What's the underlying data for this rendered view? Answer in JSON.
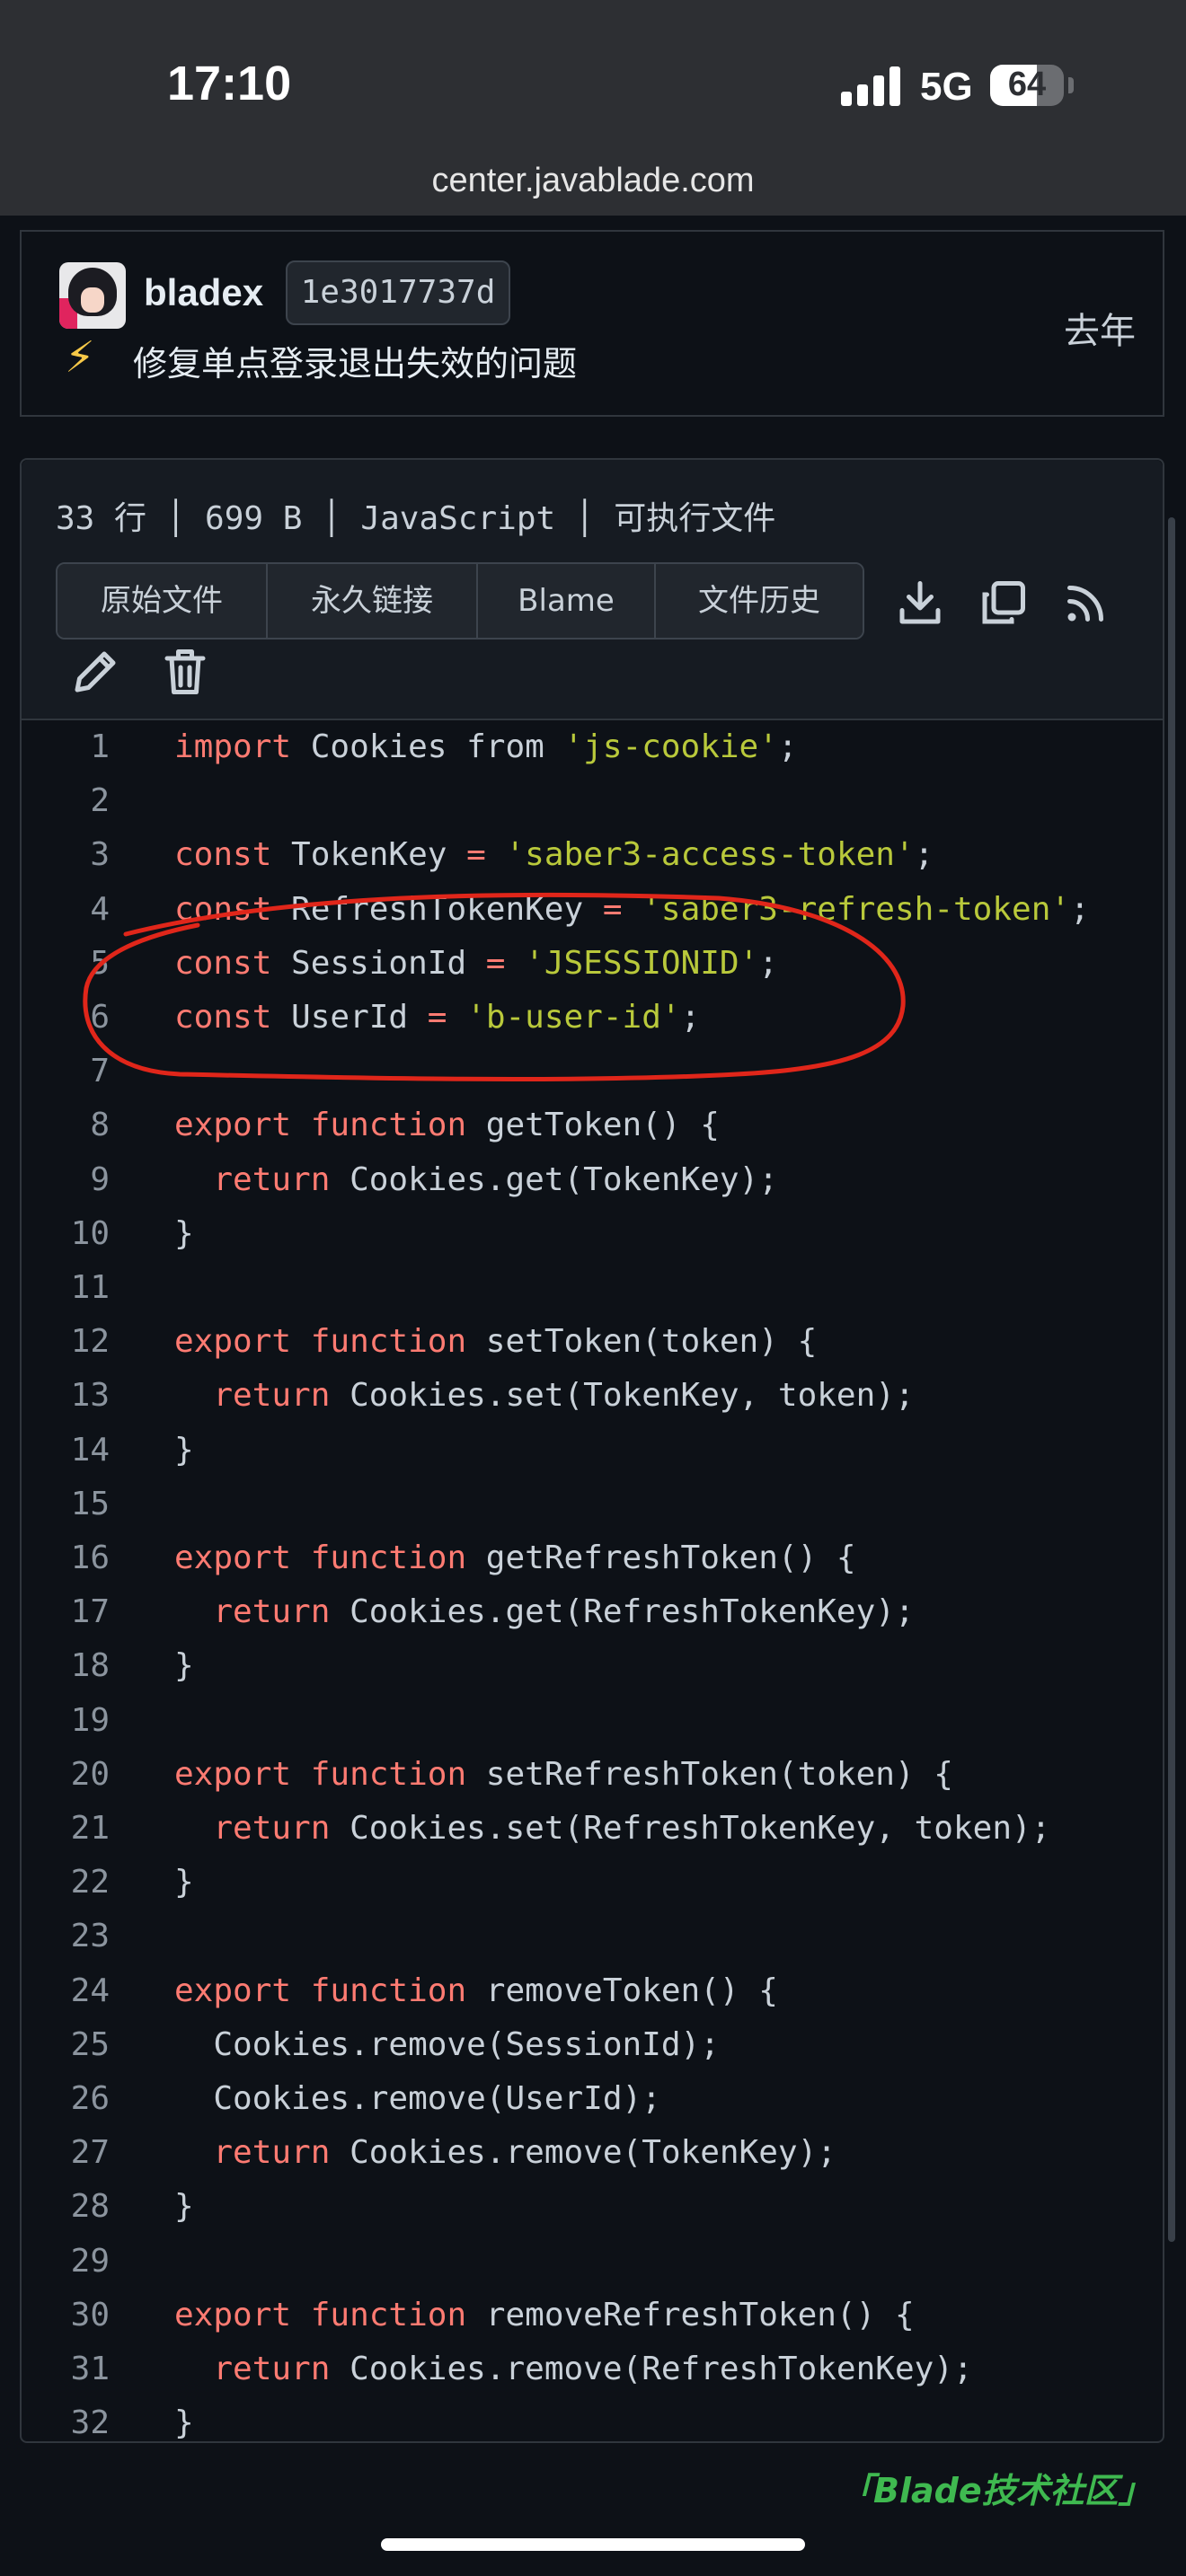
{
  "status_bar": {
    "time": "17:10",
    "network": "5G",
    "battery": 64,
    "battery_text": "64"
  },
  "browser": {
    "url": "center.javablade.com"
  },
  "commit": {
    "author": "bladex",
    "sha": "1e3017737d",
    "emoji": "⚡",
    "message": "修复单点登录退出失效的问题",
    "when": "去年"
  },
  "file": {
    "meta": "33 行 │ 699 B │ JavaScript │ 可执行文件",
    "buttons": [
      "原始文件",
      "永久链接",
      "Blame",
      "文件历史"
    ],
    "icons": [
      "download-icon",
      "copy-icon",
      "rss-icon",
      "edit-icon",
      "trash-icon"
    ]
  },
  "code": {
    "lines": [
      [
        [
          "kw",
          "import"
        ],
        [
          "t",
          " Cookies from "
        ],
        [
          "str",
          "'js-cookie'"
        ],
        [
          "t",
          ";"
        ]
      ],
      [],
      [
        [
          "kw",
          "const"
        ],
        [
          "t",
          " TokenKey "
        ],
        [
          "op",
          "="
        ],
        [
          "t",
          " "
        ],
        [
          "str",
          "'saber3-access-token'"
        ],
        [
          "t",
          ";"
        ]
      ],
      [
        [
          "kw",
          "const"
        ],
        [
          "t",
          " RefreshTokenKey "
        ],
        [
          "op",
          "="
        ],
        [
          "t",
          " "
        ],
        [
          "str",
          "'saber3-refresh-token'"
        ],
        [
          "t",
          ";"
        ]
      ],
      [
        [
          "kw",
          "const"
        ],
        [
          "t",
          " SessionId "
        ],
        [
          "op",
          "="
        ],
        [
          "t",
          " "
        ],
        [
          "str",
          "'JSESSIONID'"
        ],
        [
          "t",
          ";"
        ]
      ],
      [
        [
          "kw",
          "const"
        ],
        [
          "t",
          " UserId "
        ],
        [
          "op",
          "="
        ],
        [
          "t",
          " "
        ],
        [
          "str",
          "'b-user-id'"
        ],
        [
          "t",
          ";"
        ]
      ],
      [],
      [
        [
          "kw",
          "export"
        ],
        [
          "t",
          " "
        ],
        [
          "kw",
          "function"
        ],
        [
          "t",
          " getToken() {"
        ]
      ],
      [
        [
          "t",
          "  "
        ],
        [
          "kw",
          "return"
        ],
        [
          "t",
          " Cookies.get(TokenKey);"
        ]
      ],
      [
        [
          "t",
          "}"
        ]
      ],
      [],
      [
        [
          "kw",
          "export"
        ],
        [
          "t",
          " "
        ],
        [
          "kw",
          "function"
        ],
        [
          "t",
          " setToken(token) {"
        ]
      ],
      [
        [
          "t",
          "  "
        ],
        [
          "kw",
          "return"
        ],
        [
          "t",
          " Cookies.set(TokenKey, token);"
        ]
      ],
      [
        [
          "t",
          "}"
        ]
      ],
      [],
      [
        [
          "kw",
          "export"
        ],
        [
          "t",
          " "
        ],
        [
          "kw",
          "function"
        ],
        [
          "t",
          " getRefreshToken() {"
        ]
      ],
      [
        [
          "t",
          "  "
        ],
        [
          "kw",
          "return"
        ],
        [
          "t",
          " Cookies.get(RefreshTokenKey);"
        ]
      ],
      [
        [
          "t",
          "}"
        ]
      ],
      [],
      [
        [
          "kw",
          "export"
        ],
        [
          "t",
          " "
        ],
        [
          "kw",
          "function"
        ],
        [
          "t",
          " setRefreshToken(token) {"
        ]
      ],
      [
        [
          "t",
          "  "
        ],
        [
          "kw",
          "return"
        ],
        [
          "t",
          " Cookies.set(RefreshTokenKey, token);"
        ]
      ],
      [
        [
          "t",
          "}"
        ]
      ],
      [],
      [
        [
          "kw",
          "export"
        ],
        [
          "t",
          " "
        ],
        [
          "kw",
          "function"
        ],
        [
          "t",
          " removeToken() {"
        ]
      ],
      [
        [
          "t",
          "  Cookies.remove(SessionId);"
        ]
      ],
      [
        [
          "t",
          "  Cookies.remove(UserId);"
        ]
      ],
      [
        [
          "t",
          "  "
        ],
        [
          "kw",
          "return"
        ],
        [
          "t",
          " Cookies.remove(TokenKey);"
        ]
      ],
      [
        [
          "t",
          "}"
        ]
      ],
      [],
      [
        [
          "kw",
          "export"
        ],
        [
          "t",
          " "
        ],
        [
          "kw",
          "function"
        ],
        [
          "t",
          " removeRefreshToken() {"
        ]
      ],
      [
        [
          "t",
          "  "
        ],
        [
          "kw",
          "return"
        ],
        [
          "t",
          " Cookies.remove(RefreshTokenKey);"
        ]
      ],
      [
        [
          "t",
          "}"
        ]
      ]
    ]
  },
  "watermark": "「Blade技术社区」"
}
